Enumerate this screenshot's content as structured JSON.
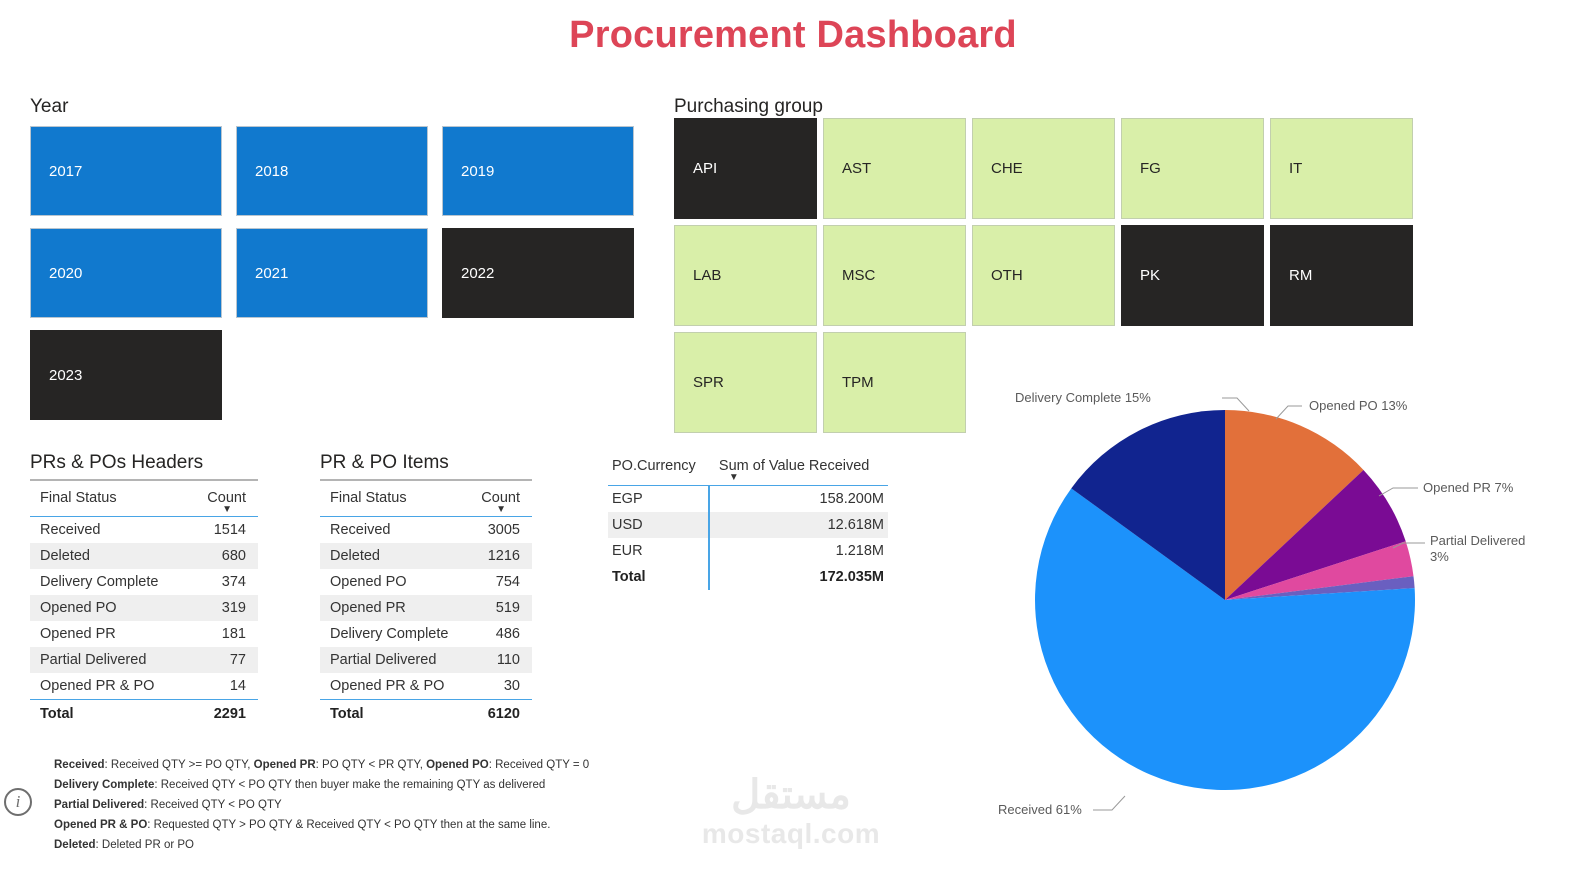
{
  "header": {
    "title": "Procurement Dashboard",
    "title_color": "#dd4557"
  },
  "slicers": {
    "year": {
      "label": "Year",
      "selected_color": "#262524",
      "unselected_color": "#1179ce",
      "items": [
        {
          "label": "2017",
          "state": "unselected"
        },
        {
          "label": "2018",
          "state": "unselected"
        },
        {
          "label": "2019",
          "state": "unselected"
        },
        {
          "label": "2020",
          "state": "unselected"
        },
        {
          "label": "2021",
          "state": "unselected"
        },
        {
          "label": "2022",
          "state": "selected"
        },
        {
          "label": "2023",
          "state": "selected"
        }
      ]
    },
    "purchasing_group": {
      "label": "Purchasing group",
      "selected_color": "#262524",
      "unselected_color": "#d9efa9",
      "items": [
        {
          "label": "API",
          "state": "selected"
        },
        {
          "label": "AST",
          "state": "unselected"
        },
        {
          "label": "CHE",
          "state": "unselected"
        },
        {
          "label": "FG",
          "state": "unselected"
        },
        {
          "label": "IT",
          "state": "unselected"
        },
        {
          "label": "LAB",
          "state": "unselected"
        },
        {
          "label": "MSC",
          "state": "unselected"
        },
        {
          "label": "OTH",
          "state": "unselected"
        },
        {
          "label": "PK",
          "state": "selected"
        },
        {
          "label": "RM",
          "state": "selected"
        },
        {
          "label": "SPR",
          "state": "unselected"
        },
        {
          "label": "TPM",
          "state": "unselected"
        }
      ]
    }
  },
  "tables": {
    "headers_table": {
      "title": "PRs & POs Headers",
      "columns": [
        "Final Status",
        "Count"
      ],
      "sort_column": "Count",
      "sort_direction": "desc",
      "rows": [
        {
          "status": "Received",
          "count": "1514"
        },
        {
          "status": "Deleted",
          "count": "680"
        },
        {
          "status": "Delivery Complete",
          "count": "374"
        },
        {
          "status": "Opened PO",
          "count": "319"
        },
        {
          "status": "Opened PR",
          "count": "181"
        },
        {
          "status": "Partial Delivered",
          "count": "77"
        },
        {
          "status": "Opened PR & PO",
          "count": "14"
        }
      ],
      "total": {
        "label": "Total",
        "count": "2291"
      }
    },
    "items_table": {
      "title": "PR & PO Items",
      "columns": [
        "Final Status",
        "Count"
      ],
      "sort_column": "Count",
      "sort_direction": "desc",
      "rows": [
        {
          "status": "Received",
          "count": "3005"
        },
        {
          "status": "Deleted",
          "count": "1216"
        },
        {
          "status": "Opened PO",
          "count": "754"
        },
        {
          "status": "Opened PR",
          "count": "519"
        },
        {
          "status": "Delivery Complete",
          "count": "486"
        },
        {
          "status": "Partial Delivered",
          "count": "110"
        },
        {
          "status": "Opened PR & PO",
          "count": "30"
        }
      ],
      "total": {
        "label": "Total",
        "count": "6120"
      }
    },
    "currency_table": {
      "columns": [
        "PO.Currency",
        "Sum of Value Received"
      ],
      "sort_column": "Sum of Value Received",
      "sort_direction": "desc",
      "rows": [
        {
          "currency": "EGP",
          "value": "158.200M"
        },
        {
          "currency": "USD",
          "value": "12.618M"
        },
        {
          "currency": "EUR",
          "value": "1.218M"
        }
      ],
      "total": {
        "label": "Total",
        "value": "172.035M"
      }
    }
  },
  "chart_data": {
    "type": "pie",
    "title": "",
    "legend": "none",
    "unit": "percent",
    "labels": [
      "Opened PO 13%",
      "Opened PR 7%",
      "Partial Delivered 3%",
      "Received 61%",
      "Delivery Complete 15%"
    ],
    "categories": [
      "Opened PO",
      "Opened PR",
      "Partial Delivered",
      "Opened PR & PO",
      "Received",
      "Delivery Complete"
    ],
    "values": [
      13,
      7,
      3,
      1,
      61,
      15
    ],
    "colors": [
      "#e2703a",
      "#7a0b94",
      "#e0499f",
      "#6a5fc0",
      "#1c92fb",
      "#11248f"
    ],
    "label_texts": {
      "opened_po": "Opened PO 13%",
      "opened_pr": "Opened PR 7%",
      "partial_delivered_l1": "Partial Delivered",
      "partial_delivered_l2": "3%",
      "received": "Received 61%",
      "delivery_complete": "Delivery Complete 15%"
    }
  },
  "footnote": {
    "icon": "info-icon",
    "lines": [
      {
        "b1": "Received",
        "t1": ": Received QTY >= PO QTY, ",
        "b2": "Opened PR",
        "t2": ": PO QTY < PR QTY, ",
        "b3": "Opened PO",
        "t3": ": Received QTY = 0"
      },
      {
        "b1": "Delivery Complete",
        "t1": ": Received QTY < PO QTY then buyer make the remaining QTY as delivered",
        "b2": "",
        "t2": "",
        "b3": "",
        "t3": ""
      },
      {
        "b1": "Partial Delivered",
        "t1": ": Received QTY < PO QTY",
        "b2": "",
        "t2": "",
        "b3": "",
        "t3": ""
      },
      {
        "b1": "Opened PR & PO",
        "t1": ": Requested QTY > PO QTY & Received QTY < PO QTY then at the same line.",
        "b2": "",
        "t2": "",
        "b3": "",
        "t3": ""
      },
      {
        "b1": "Deleted",
        "t1": ": Deleted PR or PO",
        "b2": "",
        "t2": "",
        "b3": "",
        "t3": ""
      }
    ]
  },
  "watermark": {
    "arabic": "مستقل",
    "latin": "mostaql.com"
  }
}
